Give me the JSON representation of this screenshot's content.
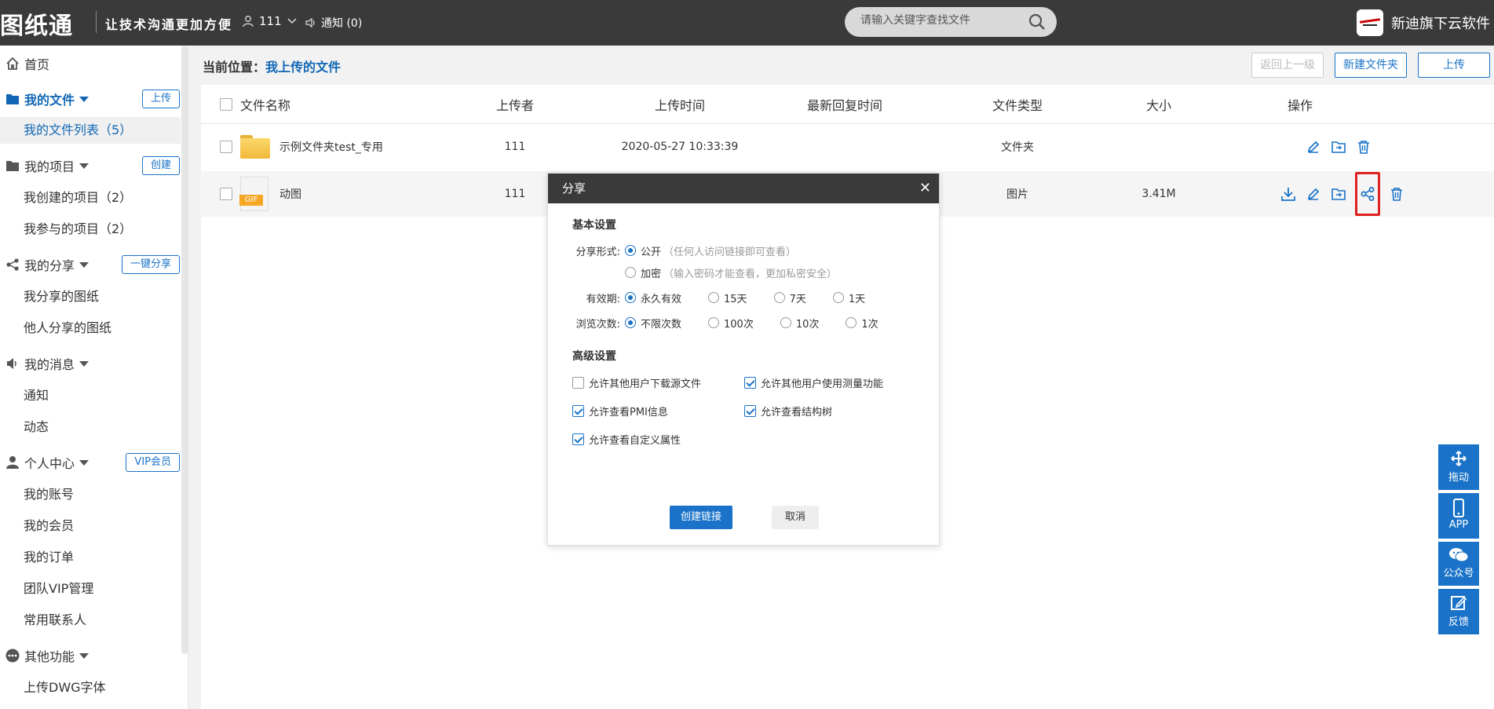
{
  "topbar": {
    "logo": "图纸通",
    "slogan": "让技术沟通更加方便",
    "user": "111",
    "notice": "通知 (0)",
    "search_placeholder": "请输入关键字查找文件",
    "brand": "新迪旗下云软件"
  },
  "sidebar": {
    "sections": [
      {
        "label": "首页"
      },
      {
        "label": "我的文件",
        "button": "上传"
      },
      {
        "label": "我的项目",
        "button": "创建"
      },
      {
        "label": "我的分享",
        "button": "一键分享"
      },
      {
        "label": "我的消息"
      },
      {
        "label": "个人中心",
        "button": "VIP会员"
      },
      {
        "label": "其他功能"
      }
    ],
    "items": {
      "file_list": "我的文件列表（5）",
      "created_projects": "我创建的项目（2）",
      "joined_projects": "我参与的项目（2）",
      "my_shared": "我分享的图纸",
      "others_shared": "他人分享的图纸",
      "notice": "通知",
      "activity": "动态",
      "account": "我的账号",
      "membership": "我的会员",
      "orders": "我的订单",
      "team_vip": "团队VIP管理",
      "contacts": "常用联系人",
      "upload_font": "上传DWG字体"
    }
  },
  "main": {
    "crumb_label": "当前位置：",
    "crumb_current": "我上传的文件",
    "buttons": {
      "back": "返回上一级",
      "new_folder": "新建文件夹",
      "upload": "上传"
    },
    "columns": [
      "文件名称",
      "上传者",
      "上传时间",
      "最新回复时间",
      "文件类型",
      "大小",
      "操作"
    ],
    "rows": [
      {
        "name": "示例文件夹test_专用",
        "uploader": "111",
        "time": "2020-05-27 10:33:39",
        "reply": "",
        "type": "文件夹",
        "size": ""
      },
      {
        "name": "动图",
        "uploader": "111",
        "time": "",
        "reply": "",
        "type": "图片",
        "size": "3.41M",
        "icon_label": "GIF"
      }
    ]
  },
  "modal": {
    "title": "分享",
    "basic": "基本设置",
    "share_form_label": "分享形式:",
    "public": "公开",
    "public_hint": "（任何人访问链接即可查看）",
    "encrypted": "加密",
    "encrypted_hint": "（输入密码才能查看，更加私密安全）",
    "validity_label": "有效期:",
    "validity": [
      "永久有效",
      "15天",
      "7天",
      "1天"
    ],
    "views_label": "浏览次数:",
    "views": [
      "不限次数",
      "100次",
      "10次",
      "1次"
    ],
    "advanced": "高级设置",
    "options": [
      {
        "label": "允许其他用户下载源文件",
        "checked": false
      },
      {
        "label": "允许其他用户使用测量功能",
        "checked": true
      },
      {
        "label": "允许查看PMI信息",
        "checked": true
      },
      {
        "label": "允许查看结构树",
        "checked": true
      },
      {
        "label": "允许查看自定义属性",
        "checked": true
      }
    ],
    "create": "创建链接",
    "cancel": "取消"
  },
  "float": {
    "drag": "拖动",
    "app": "APP",
    "wechat": "公众号",
    "feedback": "反馈"
  },
  "colors": {
    "accent": "#1a73c8",
    "topbar": "#3a3a3a",
    "highlight": "#e02020"
  }
}
